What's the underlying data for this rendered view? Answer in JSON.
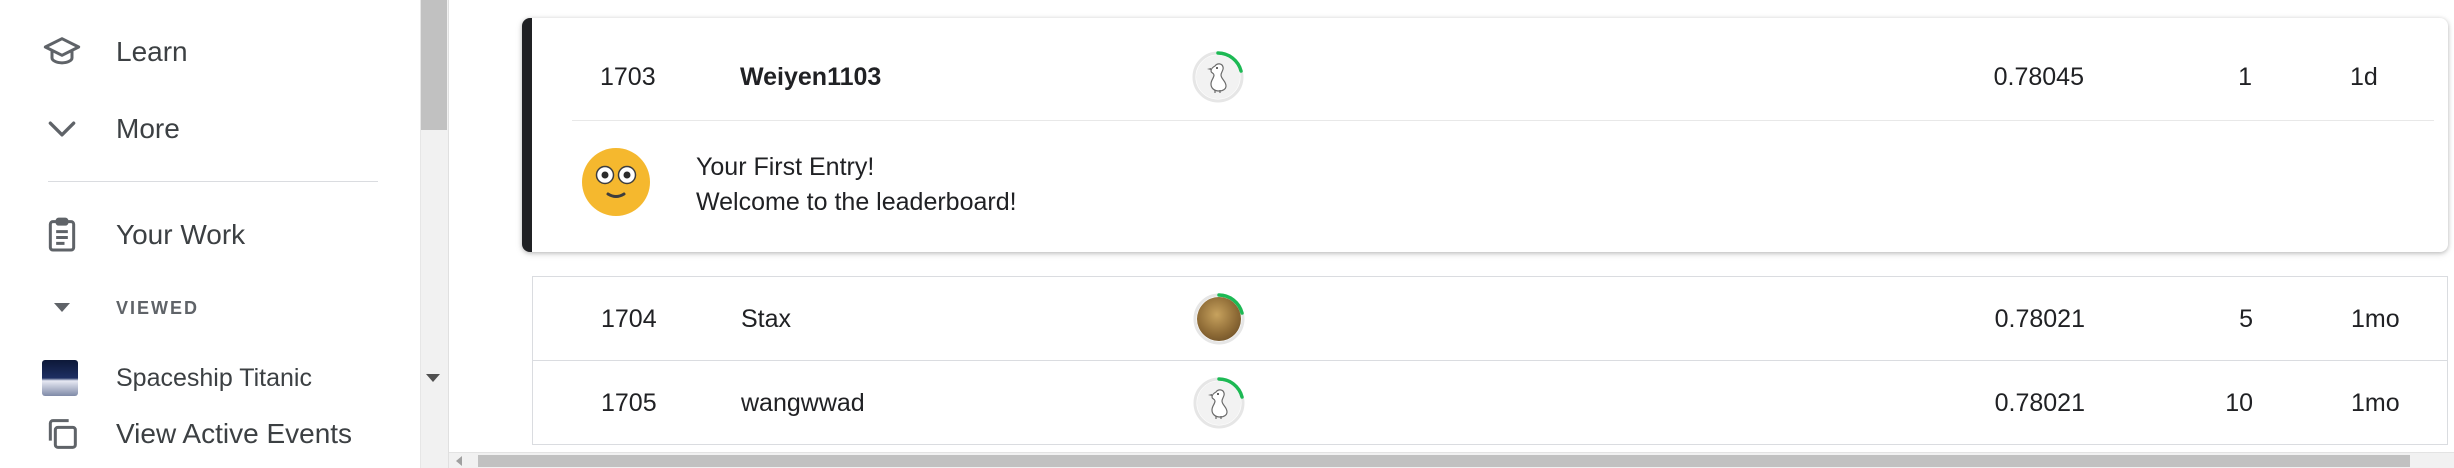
{
  "sidebar": {
    "learn_label": "Learn",
    "more_label": "More",
    "your_work_label": "Your Work",
    "viewed_header": "VIEWED",
    "viewed_items": [
      {
        "label": "Spaceship Titanic"
      }
    ],
    "view_active_events_label": "View Active Events"
  },
  "leaderboard": {
    "highlighted_row": {
      "rank": "1703",
      "team": "Weiyen1103",
      "score": "0.78045",
      "entries": "1",
      "last": "1d"
    },
    "highlight_message": {
      "title": "Your First Entry!",
      "body": "Welcome to the leaderboard!"
    },
    "rows": [
      {
        "rank": "1704",
        "team": "Stax",
        "score": "0.78021",
        "entries": "5",
        "last": "1mo"
      },
      {
        "rank": "1705",
        "team": "wangwwad",
        "score": "0.78021",
        "entries": "10",
        "last": "1mo"
      }
    ]
  },
  "colors": {
    "accent_green": "#20beff",
    "progress_green": "#1db954",
    "emoji_yellow": "#f5b82e"
  }
}
